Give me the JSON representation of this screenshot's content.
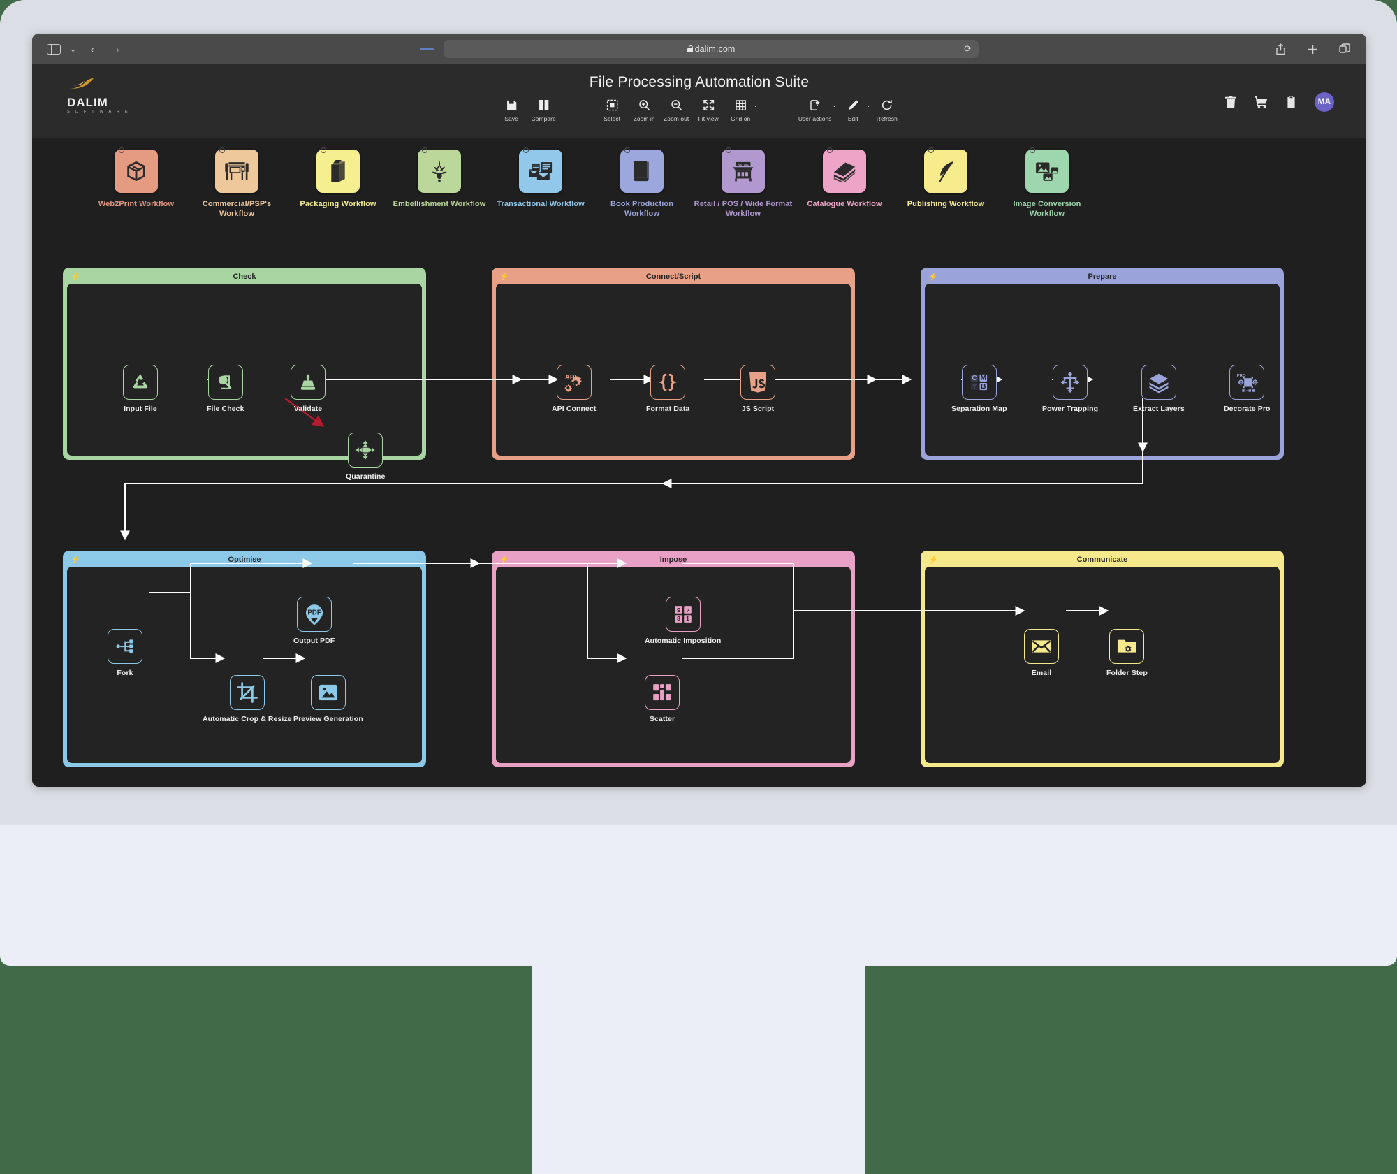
{
  "browser": {
    "url": "dalim.com",
    "nav": {
      "back": "‹",
      "forward": "›"
    },
    "buttons": {
      "share": "share-icon",
      "new_tab": "+",
      "tabs": "tabs-icon"
    }
  },
  "app": {
    "title": "File Processing Automation Suite",
    "brand": {
      "name": "DALIM",
      "tagline": "S O F T W A R E"
    },
    "header_icons": [
      {
        "name": "trash-icon"
      },
      {
        "name": "cart-icon"
      },
      {
        "name": "clipboard-icon"
      }
    ],
    "avatar": "MA"
  },
  "toolbar": {
    "items": [
      {
        "label": "Save",
        "icon": "save-icon",
        "caret": false
      },
      {
        "label": "Compare",
        "icon": "compare-icon",
        "caret": false
      },
      {
        "label": "Select",
        "icon": "select-icon",
        "caret": false
      },
      {
        "label": "Zoom in",
        "icon": "zoom-in-icon",
        "caret": false
      },
      {
        "label": "Zoom out",
        "icon": "zoom-out-icon",
        "caret": false
      },
      {
        "label": "Fit view",
        "icon": "fit-view-icon",
        "caret": false
      },
      {
        "label": "Grid on",
        "icon": "grid-icon",
        "caret": true
      },
      {
        "label": "User actions",
        "icon": "user-actions-icon",
        "caret": true
      },
      {
        "label": "Edit",
        "icon": "pencil-icon",
        "caret": true
      },
      {
        "label": "Refresh",
        "icon": "refresh-icon",
        "caret": false
      }
    ]
  },
  "workflows": [
    {
      "label": "Web2Print Workflow",
      "icon": "box-icon",
      "tile": "#e59a82",
      "text": "#e59a82"
    },
    {
      "label": "Commercial/PSP's Workflow",
      "icon": "press-icon",
      "tile": "#eec79a",
      "text": "#eec79a"
    },
    {
      "label": "Packaging Workflow",
      "icon": "carton-icon",
      "tile": "#f5ef8f",
      "text": "#f5ef8f"
    },
    {
      "label": "Embellishment Workflow",
      "icon": "ornament-icon",
      "tile": "#bcd79a",
      "text": "#bcd79a"
    },
    {
      "label": "Transactional Workflow",
      "icon": "mail-docs-icon",
      "tile": "#92c9ea",
      "text": "#92c9ea"
    },
    {
      "label": "Book Production Workflow",
      "icon": "book-icon",
      "tile": "#9ca7de",
      "text": "#9ca7de"
    },
    {
      "label": "Retail / POS / Wide Format Workflow",
      "icon": "storefront-icon",
      "tile": "#b198cf",
      "text": "#b198cf"
    },
    {
      "label": "Catalogue Workflow",
      "icon": "catalogue-icon",
      "tile": "#eda4c6",
      "text": "#eda4c6"
    },
    {
      "label": "Publishing Workflow",
      "icon": "quill-icon",
      "tile": "#f7ec8c",
      "text": "#f7ec8c"
    },
    {
      "label": "Image Conversion Workflow",
      "icon": "images-icon",
      "tile": "#9ed6ad",
      "text": "#9ed6ad"
    }
  ],
  "groups": [
    {
      "id": "check",
      "title": "Check",
      "color": "#a8d5a2",
      "nodes": [
        {
          "label": "Input File",
          "icon": "recycle-icon"
        },
        {
          "label": "File Check",
          "icon": "magnifier-doc-icon"
        },
        {
          "label": "Validate",
          "icon": "stamp-icon"
        },
        {
          "label": "Quarantine",
          "icon": "quarantine-icon"
        }
      ]
    },
    {
      "id": "connect-script",
      "title": "Connect/Script",
      "color": "#e8a186",
      "nodes": [
        {
          "label": "API Connect",
          "icon": "api-gears-icon"
        },
        {
          "label": "Format Data",
          "icon": "braces-icon"
        },
        {
          "label": "JS Script",
          "icon": "js-icon"
        }
      ]
    },
    {
      "id": "prepare",
      "title": "Prepare",
      "color": "#9aa4db",
      "nodes": [
        {
          "label": "Separation Map",
          "icon": "cmyk-icon"
        },
        {
          "label": "Power Trapping",
          "icon": "trapping-icon"
        },
        {
          "label": "Extract Layers",
          "icon": "layers-icon"
        },
        {
          "label": "Decorate Pro",
          "icon": "decorate-pro-icon"
        }
      ]
    },
    {
      "id": "optimise",
      "title": "Optimise",
      "color": "#8cc8e8",
      "nodes": [
        {
          "label": "Fork",
          "icon": "fork-icon"
        },
        {
          "label": "Output PDF",
          "icon": "pdf-icon"
        },
        {
          "label": "Automatic Crop & Resize",
          "icon": "crop-icon"
        },
        {
          "label": "Preview Generation",
          "icon": "image-icon"
        }
      ]
    },
    {
      "id": "impose",
      "title": "Impose",
      "color": "#e8a0c4",
      "nodes": [
        {
          "label": "Automatic Imposition",
          "icon": "imposition-icon"
        },
        {
          "label": "Scatter",
          "icon": "scatter-icon"
        }
      ]
    },
    {
      "id": "communicate",
      "title": "Communicate",
      "color": "#f5e98c",
      "nodes": [
        {
          "label": "Email",
          "icon": "envelope-icon"
        },
        {
          "label": "Folder Step",
          "icon": "folder-gear-icon"
        }
      ]
    }
  ]
}
